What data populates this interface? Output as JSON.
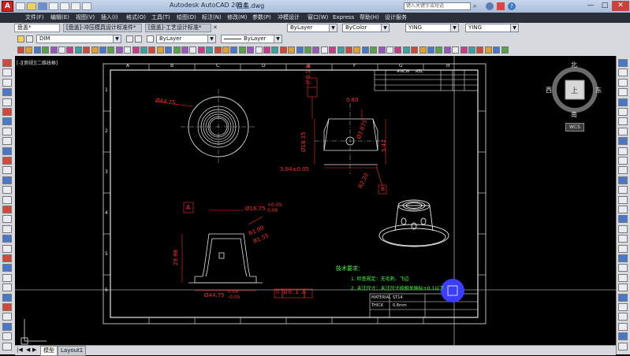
{
  "app": {
    "title": "Autodesk AutoCAD 2014",
    "file_title": "盘盖.dwg",
    "search_placeholder": "键入关键字或短语",
    "window_controls": [
      "—",
      "□",
      "✕"
    ]
  },
  "menu": {
    "items": [
      "文件(F)",
      "编辑(E)",
      "视图(V)",
      "插入(I)",
      "格式(O)",
      "工具(T)",
      "绘图(D)",
      "标注(N)",
      "修改(M)",
      "参数(P)",
      "冲模设计",
      "窗口(W)",
      "Express",
      "帮助(H)",
      "设计服务"
    ]
  },
  "tabs": [
    {
      "label": "盘盖*",
      "active": true
    },
    {
      "label": "[盘盖]-冲压模具设计标准件*",
      "active": false
    },
    {
      "label": "[盘盖]-工艺设计标准*",
      "active": false
    }
  ],
  "properties_bar": {
    "dimstyle": "DIM",
    "layer": "ByLayer",
    "linetype": "ByLayer",
    "lineweight": "ByLayer",
    "color": "ByColor",
    "textstyle1": "YING",
    "textstyle2": "YING"
  },
  "viewport_label": "[-][俯视][二维线框]",
  "viewcube": {
    "north": "北",
    "south": "南",
    "east": "东",
    "west": "西",
    "face": "上",
    "wcs": "WCS"
  },
  "drawing": {
    "col_markers": [
      "A",
      "B",
      "C",
      "D",
      "E",
      "F",
      "G",
      "H"
    ],
    "row_markers": [
      "1",
      "2",
      "3",
      "4",
      "5",
      "6"
    ],
    "dims": {
      "top_dia": "Ø44.75",
      "tol_frame1": "// 0.1 B",
      "d080": "0.80",
      "d1835": "Ø18.35",
      "d3875": "Ø3.875",
      "d547": "5.47",
      "d394": "3.94±0.05",
      "r220": "R2.20",
      "datum_b": "B",
      "datum_a": "A",
      "d1675": "Ø16.75",
      "tol_plus": "+0.05",
      "tol_zero": "0.00",
      "r100": "R1.00",
      "r155": "R1.55",
      "h2999": "29.98",
      "bot_dia": "Ø44.75",
      "bot_tol_a": "0.00",
      "bot_tol_b": "-0.05",
      "runout": "⊙ Ø0.1 A"
    },
    "notes": {
      "title": "技术要求：",
      "line1": "1. 检查规定：无毛刺、飞边",
      "line2": "2. 未注尺寸：未注尺寸按相关国标±0.1以下"
    },
    "title_block": {
      "material_label": "MATERIAL",
      "material_val": "ST14",
      "thk_label": "THICK",
      "thk_val": "0.8mm",
      "head1": "#NCW",
      "head2": "ASL"
    }
  },
  "statusbar": {
    "tab_model": "模型",
    "tab_layout": "Layout1"
  },
  "colors": {
    "accent": "#3a3dff",
    "dim_red": "#ff2a2a",
    "note_green": "#37ff37",
    "line_white": "#e6e6e6"
  }
}
